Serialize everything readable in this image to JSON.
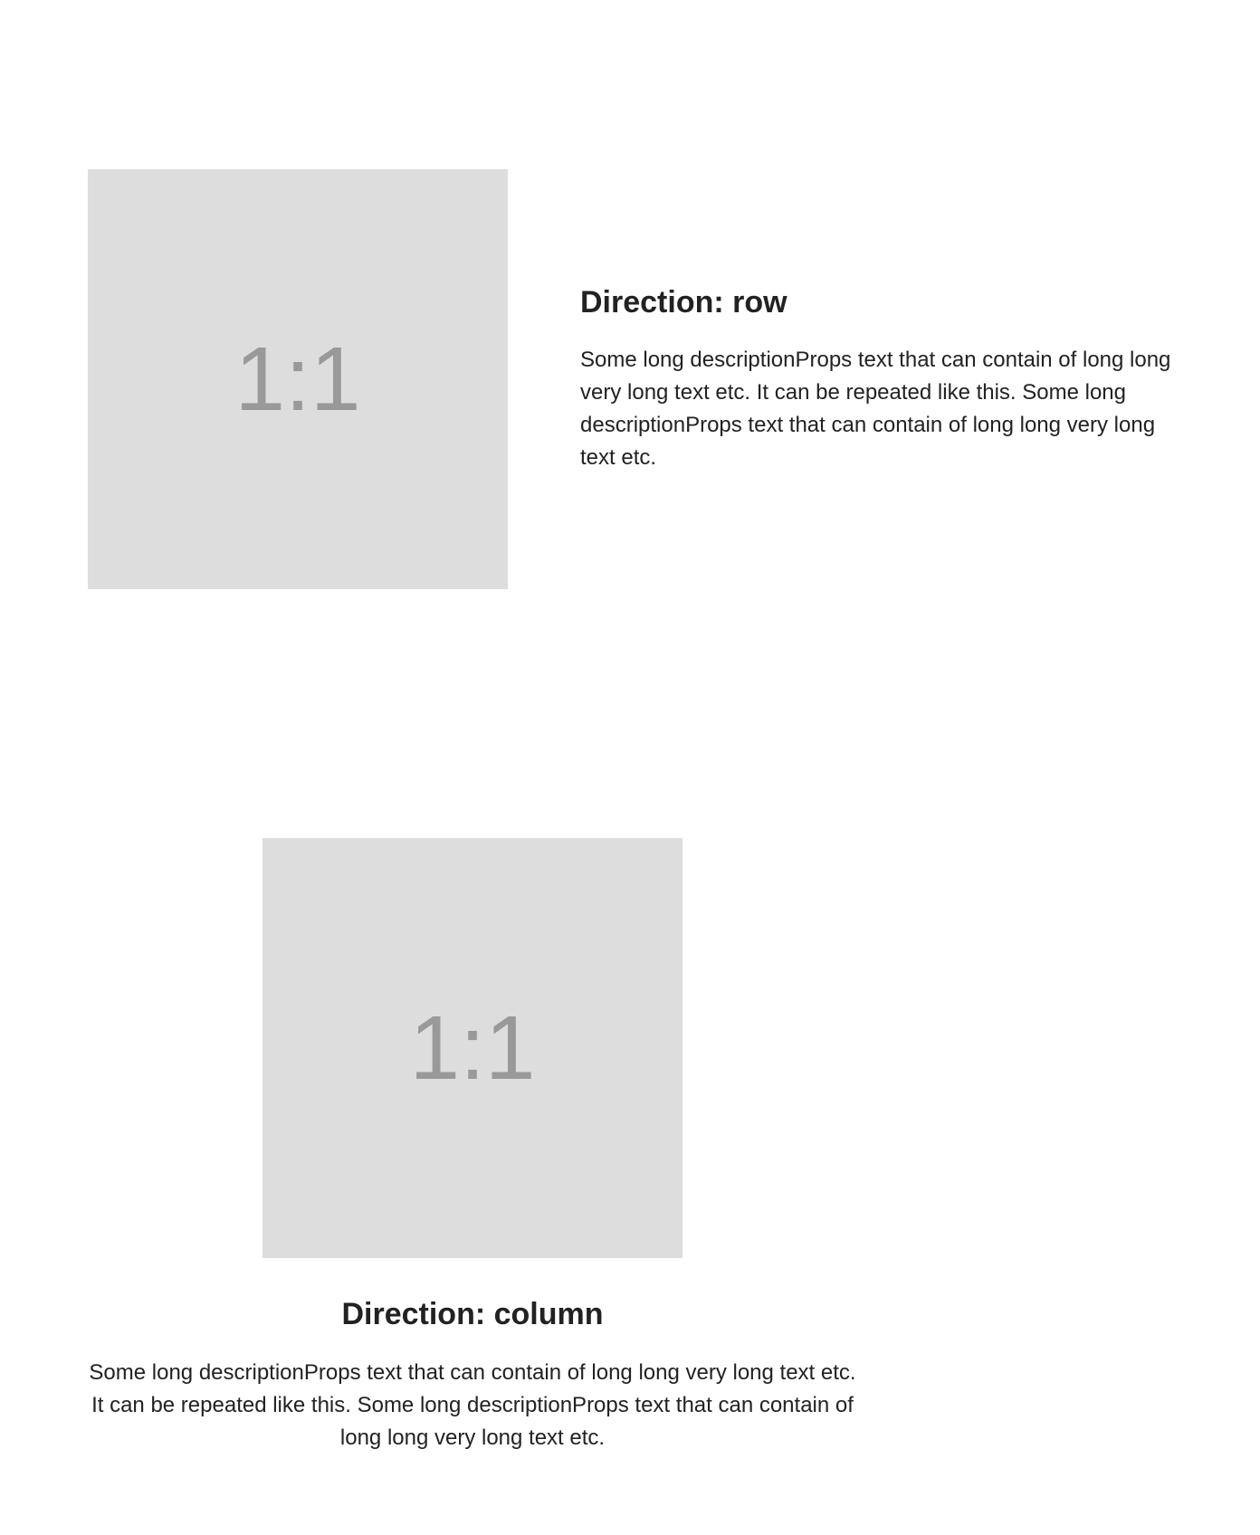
{
  "row_example": {
    "media_label": "1:1",
    "title": "Direction: row",
    "description": "Some long descriptionProps text that can contain of long long very long text etc. It can be repeated like this. Some long descriptionProps text that can contain of long long very long text etc."
  },
  "column_example": {
    "media_label": "1:1",
    "title": "Direction: column",
    "description": "Some long descriptionProps text that can contain of long long very long text etc. It can be repeated like this. Some long descriptionProps text that can contain of long long very long text etc."
  },
  "colors": {
    "placeholder_background": "#dddddd",
    "placeholder_text": "#999999",
    "text": "#222222"
  }
}
